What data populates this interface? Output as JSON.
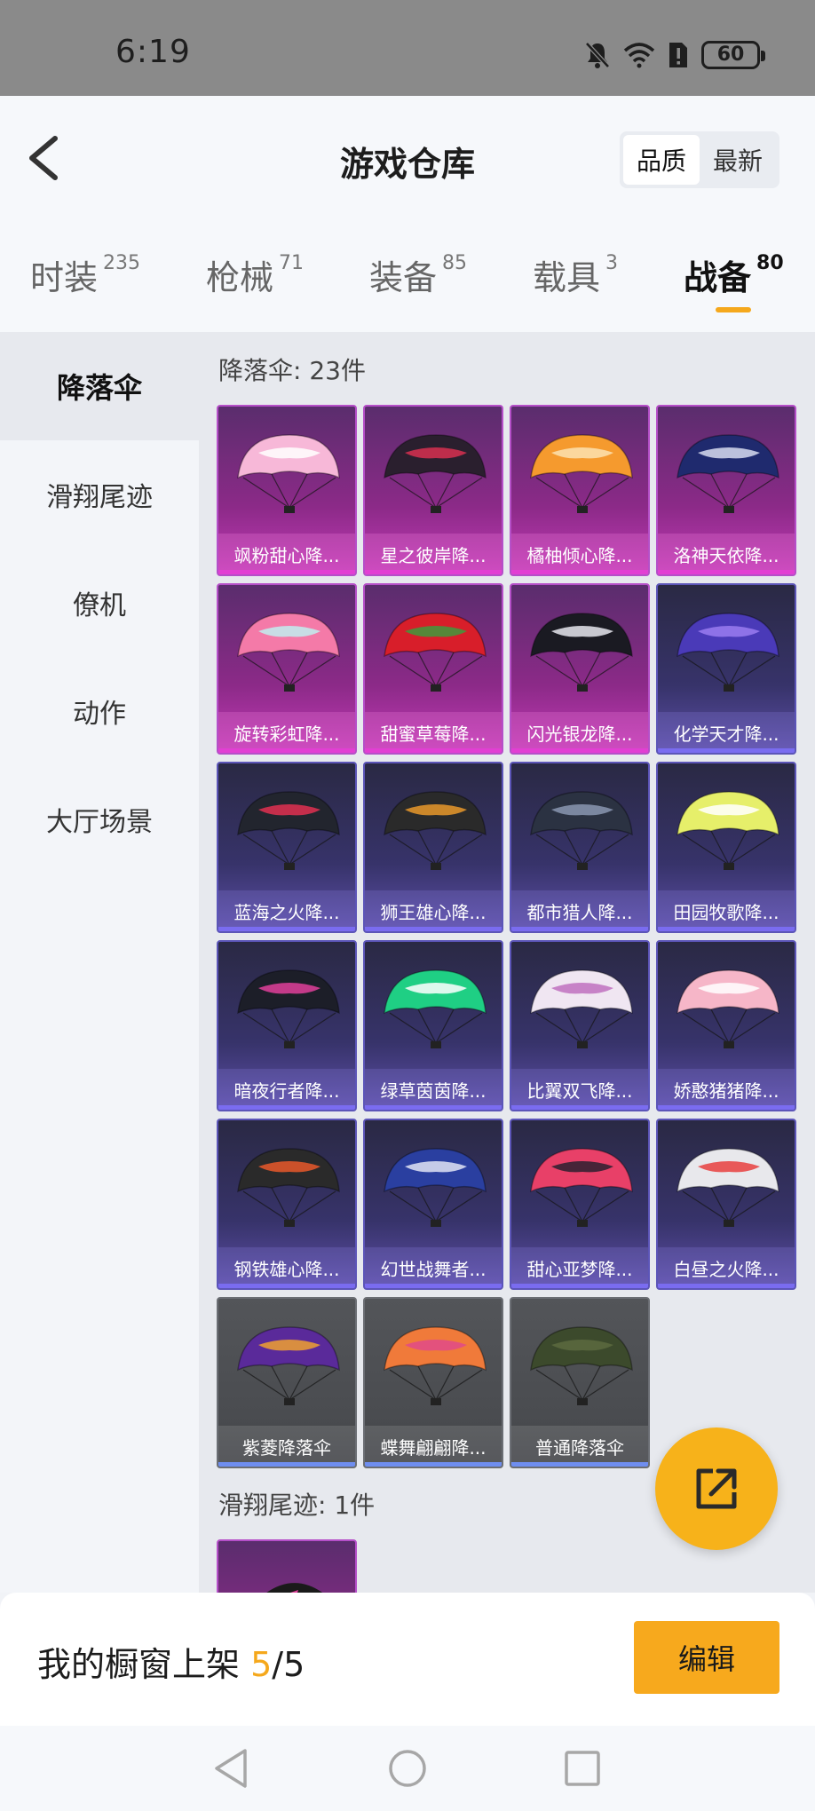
{
  "status_bar": {
    "time": "6:19",
    "battery": "60"
  },
  "header": {
    "title": "游戏仓库",
    "sort_options": [
      "品质",
      "最新"
    ]
  },
  "categories": [
    {
      "label": "时装",
      "count": "235"
    },
    {
      "label": "枪械",
      "count": "71"
    },
    {
      "label": "装备",
      "count": "85"
    },
    {
      "label": "载具",
      "count": "3"
    },
    {
      "label": "战备",
      "count": "80"
    }
  ],
  "sidebar": {
    "items": [
      {
        "label": "降落伞"
      },
      {
        "label": "滑翔尾迹"
      },
      {
        "label": "僚机"
      },
      {
        "label": "动作"
      },
      {
        "label": "大厅场景"
      }
    ]
  },
  "sections": {
    "parachute_title": "降落伞: 23件",
    "trail_title": "滑翔尾迹: 1件"
  },
  "items": [
    {
      "name": "飒粉甜心降...",
      "tier": "pink",
      "c1": "#f7b8d8",
      "c2": "#ffffff"
    },
    {
      "name": "星之彼岸降...",
      "tier": "pink",
      "c1": "#2a1f2e",
      "c2": "#d83050"
    },
    {
      "name": "橘柚倾心降...",
      "tier": "pink",
      "c1": "#f59a2e",
      "c2": "#fbe2b0"
    },
    {
      "name": "洛神天依降...",
      "tier": "pink",
      "c1": "#1f2a6e",
      "c2": "#d8dcf0"
    },
    {
      "name": "旋转彩虹降...",
      "tier": "pink",
      "c1": "#f47aa8",
      "c2": "#bfeef0"
    },
    {
      "name": "甜蜜草莓降...",
      "tier": "pink",
      "c1": "#d81e2a",
      "c2": "#3f9a3c"
    },
    {
      "name": "闪光银龙降...",
      "tier": "pink",
      "c1": "#1a1a22",
      "c2": "#e8e8ee"
    },
    {
      "name": "化学天才降...",
      "tier": "purple",
      "c1": "#4a3ab8",
      "c2": "#9a7cf0"
    },
    {
      "name": "蓝海之火降...",
      "tier": "purple",
      "c1": "#22252e",
      "c2": "#e03050"
    },
    {
      "name": "狮王雄心降...",
      "tier": "purple",
      "c1": "#2a2a2a",
      "c2": "#e8982a"
    },
    {
      "name": "都市猎人降...",
      "tier": "purple",
      "c1": "#2b3242",
      "c2": "#8a96b0"
    },
    {
      "name": "田园牧歌降...",
      "tier": "purple",
      "c1": "#e6ef6a",
      "c2": "#ffffff"
    },
    {
      "name": "暗夜行者降...",
      "tier": "purple",
      "c1": "#1c1e28",
      "c2": "#e0409a"
    },
    {
      "name": "绿草茵茵降...",
      "tier": "purple",
      "c1": "#1fcf84",
      "c2": "#ffffff"
    },
    {
      "name": "比翼双飞降...",
      "tier": "purple",
      "c1": "#f0e6f2",
      "c2": "#c070c0"
    },
    {
      "name": "娇憨猪猪降...",
      "tier": "purple",
      "c1": "#f6b6c8",
      "c2": "#ffffff"
    },
    {
      "name": "钢铁雄心降...",
      "tier": "purple",
      "c1": "#2a2a2a",
      "c2": "#e8582a"
    },
    {
      "name": "幻世战舞者...",
      "tier": "purple",
      "c1": "#2a3fa0",
      "c2": "#e0e4f4"
    },
    {
      "name": "甜心亚梦降...",
      "tier": "purple",
      "c1": "#e84068",
      "c2": "#2a2030"
    },
    {
      "name": "白昼之火降...",
      "tier": "purple",
      "c1": "#e8e8ec",
      "c2": "#e84040"
    },
    {
      "name": "紫菱降落伞",
      "tier": "gray",
      "c1": "#5a2a9a",
      "c2": "#f0a030"
    },
    {
      "name": "蝶舞翩翩降...",
      "tier": "gray",
      "c1": "#f07a3a",
      "c2": "#e04a8a"
    },
    {
      "name": "普通降落伞",
      "tier": "gray",
      "c1": "#3c4a2c",
      "c2": "#5c6a40"
    }
  ],
  "bottom_bar": {
    "showcase_label": "我的橱窗上架",
    "showcase_current": "5",
    "showcase_total": "/5",
    "edit_label": "编辑"
  },
  "colors": {
    "accent": "#f5a81c",
    "pink_tier": "#e23fd3",
    "purple_tier": "#7a6cf0"
  }
}
